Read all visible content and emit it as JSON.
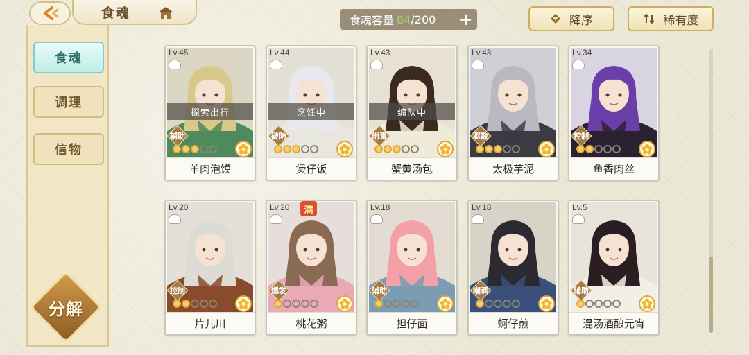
{
  "header": {
    "title": "食魂",
    "capacity_label": "食魂容量",
    "capacity_count": "84",
    "capacity_max": "/200",
    "add_label": "+",
    "sort_order_label": "降序",
    "sort_rarity_label": "稀有度"
  },
  "sidebar": {
    "items": [
      {
        "label": "食魂",
        "active": true
      },
      {
        "label": "调理",
        "active": false
      },
      {
        "label": "信物",
        "active": false
      }
    ],
    "split_label": "分解"
  },
  "cards": [
    {
      "level": "Lv.45",
      "name": "羊肉泡馍",
      "status": "探索出行",
      "role": "辅助",
      "stars": 3,
      "hair": "#d8c98a",
      "outfit": "#4f8a5c",
      "bg": "#dcd6c4"
    },
    {
      "level": "Lv.44",
      "name": "煲仔饭",
      "status": "烹饪中",
      "role": "破防",
      "stars": 3,
      "hair": "#e8e8ee",
      "outfit": "#e8e6de",
      "bg": "#e3e0d6"
    },
    {
      "level": "Lv.43",
      "name": "蟹黄汤包",
      "status": "编队中",
      "role": "附毒",
      "stars": 3,
      "hair": "#3a2a22",
      "outfit": "#f0ead8",
      "bg": "#e6e1d3"
    },
    {
      "level": "Lv.43",
      "name": "太极芋泥",
      "status": "",
      "role": "驱散",
      "stars": 3,
      "hair": "#b9b9c2",
      "outfit": "#3b3b44",
      "bg": "#cfcfd6"
    },
    {
      "level": "Lv.34",
      "name": "鱼香肉丝",
      "status": "",
      "role": "控制",
      "stars": 2,
      "hair": "#6a3fa8",
      "outfit": "#2a2230",
      "bg": "#d9d4e2"
    },
    {
      "level": "Lv.20",
      "name": "片儿川",
      "status": "",
      "role": "控制",
      "stars": 2,
      "hair": "#dcdcd4",
      "outfit": "#8a4a2c",
      "bg": "#e2e0d8"
    },
    {
      "level": "Lv.20",
      "name": "桃花粥",
      "status": "",
      "role": "爆发",
      "stars": 1,
      "hair": "#8a6a52",
      "outfit": "#e9a9b6",
      "bg": "#e6dedb",
      "badge": "满"
    },
    {
      "level": "Lv.18",
      "name": "担仔面",
      "status": "",
      "role": "辅助",
      "stars": 1,
      "hair": "#f3a0a6",
      "outfit": "#7a9db3",
      "bg": "#e4dcd3"
    },
    {
      "level": "Lv.18",
      "name": "蚵仔煎",
      "status": "",
      "role": "嘲讽",
      "stars": 1,
      "hair": "#2b2a30",
      "outfit": "#3a4f7a",
      "bg": "#d7d3c6"
    },
    {
      "level": "Lv.5",
      "name": "混汤酒酿元宵",
      "status": "",
      "role": "辅助",
      "stars": 1,
      "hair": "#2a1e22",
      "outfit": "#f2efe6",
      "bg": "#e8e4da"
    }
  ]
}
